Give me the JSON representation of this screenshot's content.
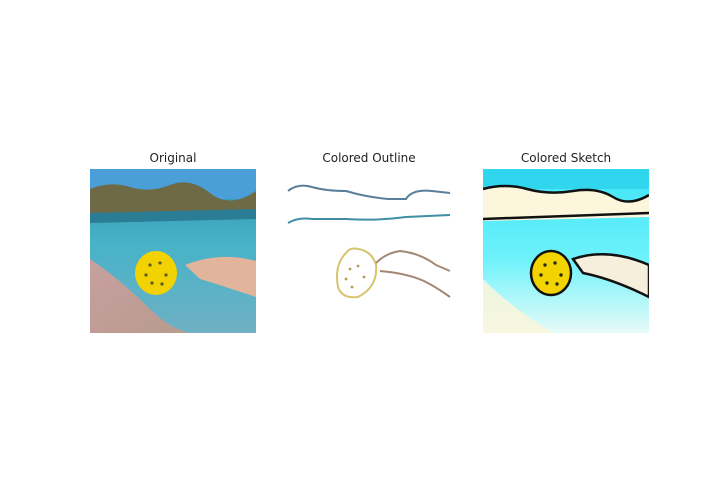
{
  "figure": {
    "panels": [
      {
        "title": "Original"
      },
      {
        "title": "Colored Outline"
      },
      {
        "title": "Colored Sketch"
      }
    ]
  },
  "colors": {
    "sky": "#3f9ad6",
    "hills": "#6b6a46",
    "sea": "#3fb0c6",
    "sand": "#c8aa9c",
    "frisbee": "#f4d400",
    "skin": "#e4b49c",
    "sketch_sky": "#2fd6ee",
    "sketch_sand": "#fbf6dc",
    "outline": "#111111"
  }
}
